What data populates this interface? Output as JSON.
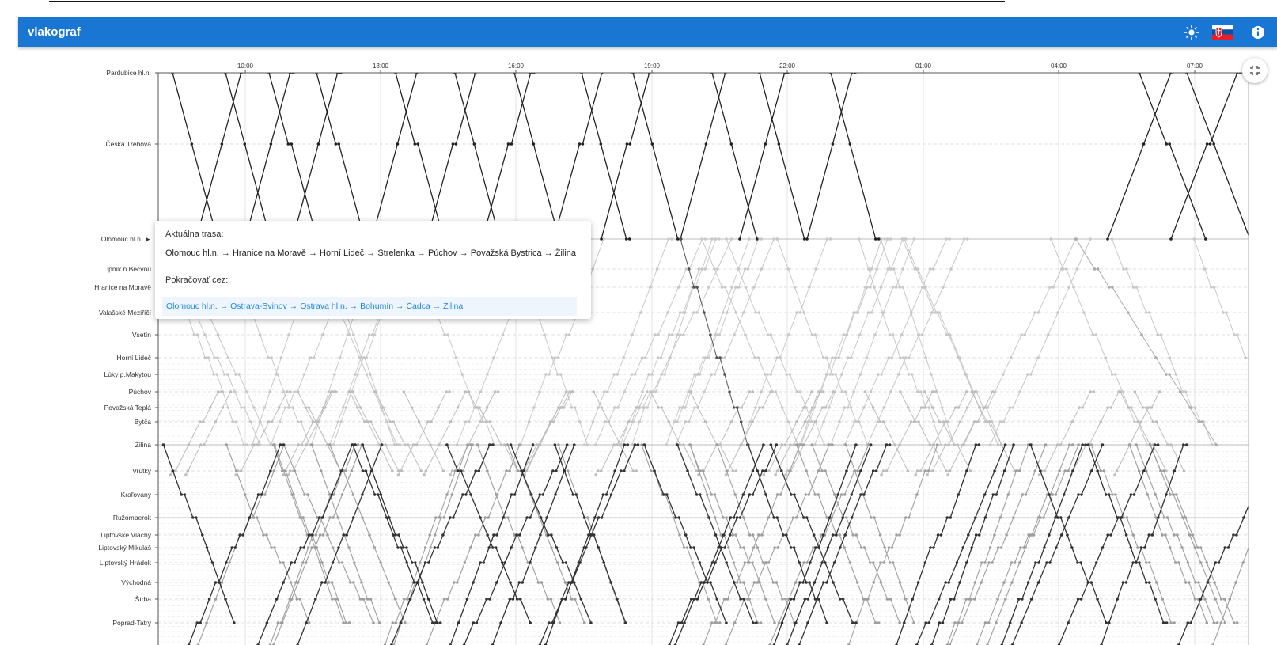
{
  "app": {
    "title": "vlakograf"
  },
  "toolbar": {
    "theme_icon": "sun-icon",
    "language_icon": "slovak-flag-icon",
    "info_icon": "info-icon"
  },
  "colors": {
    "appbar": "#1976d2",
    "alt_route_link": "#1e88e5",
    "alt_route_bg": "#eef5fc"
  },
  "graph": {
    "time_ticks": [
      "10:00",
      "13:00",
      "16:00",
      "19:00",
      "22:00",
      "01:00",
      "04:00",
      "07:00"
    ],
    "stations": [
      "Pardubice hl.n.",
      "Česká Třebová",
      "Olomouc hl.n. ►",
      "Lipník n.Bečvou",
      "Hranice na Moravě",
      "Valašské Meziříčí",
      "Vsetín",
      "Horní Lideč",
      "Lúky p.Makytou",
      "Púchov",
      "Považská Teplá",
      "Bytča",
      "Žilina",
      "Vrútky",
      "Kraľovany",
      "Ružomberok",
      "Liptovské Vlachy",
      "Liptovský Mikuláš",
      "Liptovský Hrádok",
      "Východná",
      "Štrba",
      "Poprad-Tatry"
    ]
  },
  "tooltip": {
    "current_label": "Aktuálna trasa:",
    "current_route": "Olomouc hl.n. → Hranice na Moravě → Horní Lideč → Strelenka → Púchov → Považská Bystrica → Žilina",
    "continue_label": "Pokračovať cez:",
    "alternative_route": "Olomouc hl.n. → Ostrava-Svinov → Ostrava hl.n. → Bohumín → Čadca → Žilina"
  }
}
